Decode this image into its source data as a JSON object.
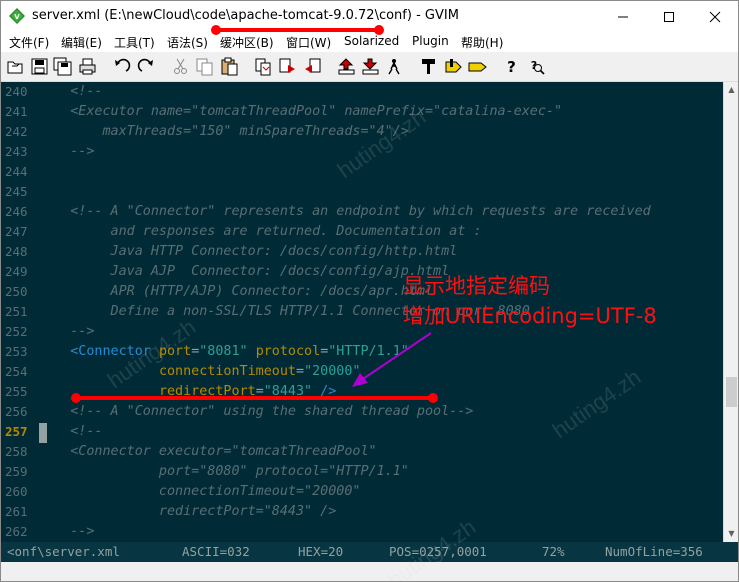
{
  "window": {
    "title": "server.xml (E:\\newCloud\\code\\apache-tomcat-9.0.72\\conf) - GVIM"
  },
  "menu": {
    "items": [
      "文件(F)",
      "编辑(E)",
      "工具(T)",
      "语法(S)",
      "缓冲区(B)",
      "窗口(W)",
      "Solarized",
      "Plugin",
      "帮助(H)"
    ]
  },
  "toolbar": {
    "icons": [
      "open-icon",
      "save-icon",
      "save-all-icon",
      "print-icon",
      "undo-icon",
      "redo-icon",
      "cut-icon",
      "copy-icon",
      "paste-icon",
      "replace-icon",
      "find-next-icon",
      "find-prev-icon",
      "load-session-icon",
      "save-session-icon",
      "run-script-icon",
      "make-icon",
      "run-ctags-icon",
      "jump-tag-icon",
      "help-icon",
      "find-help-icon"
    ]
  },
  "editor": {
    "cursor_line": "257",
    "lines": [
      {
        "num": "240",
        "tokens": [
          {
            "t": "    <!--",
            "c": "comment"
          }
        ]
      },
      {
        "num": "241",
        "tokens": [
          {
            "t": "    <Executor name=\"tomcatThreadPool\" namePrefix=\"catalina-exec-\"",
            "c": "comment"
          }
        ]
      },
      {
        "num": "242",
        "tokens": [
          {
            "t": "        maxThreads=\"150\" minSpareThreads=\"4\"/>",
            "c": "comment"
          }
        ]
      },
      {
        "num": "243",
        "tokens": [
          {
            "t": "    -->",
            "c": "comment"
          }
        ]
      },
      {
        "num": "244",
        "tokens": []
      },
      {
        "num": "245",
        "tokens": []
      },
      {
        "num": "246",
        "tokens": [
          {
            "t": "    <!-- A \"Connector\" represents an endpoint by which requests are received",
            "c": "comment"
          }
        ]
      },
      {
        "num": "247",
        "tokens": [
          {
            "t": "         and responses are returned. Documentation at :",
            "c": "comment"
          }
        ]
      },
      {
        "num": "248",
        "tokens": [
          {
            "t": "         Java HTTP Connector: /docs/config/http.html",
            "c": "comment"
          }
        ]
      },
      {
        "num": "249",
        "tokens": [
          {
            "t": "         Java AJP  Connector: /docs/config/ajp.html",
            "c": "comment"
          }
        ]
      },
      {
        "num": "250",
        "tokens": [
          {
            "t": "         APR (HTTP/AJP) Connector: /docs/apr.html",
            "c": "comment"
          }
        ]
      },
      {
        "num": "251",
        "tokens": [
          {
            "t": "         Define a non-SSL/TLS HTTP/1.1 Connector on port 8080",
            "c": "comment"
          }
        ]
      },
      {
        "num": "252",
        "tokens": [
          {
            "t": "    -->",
            "c": "comment"
          }
        ]
      },
      {
        "num": "253",
        "tokens": [
          {
            "t": "    ",
            "c": "text"
          },
          {
            "t": "<Connector",
            "c": "tag"
          },
          {
            "t": " ",
            "c": "text"
          },
          {
            "t": "port",
            "c": "attr"
          },
          {
            "t": "=",
            "c": "text"
          },
          {
            "t": "\"8081\"",
            "c": "str"
          },
          {
            "t": " ",
            "c": "text"
          },
          {
            "t": "protocol",
            "c": "attr"
          },
          {
            "t": "=",
            "c": "text"
          },
          {
            "t": "\"HTTP/1.1\"",
            "c": "str"
          }
        ]
      },
      {
        "num": "254",
        "tokens": [
          {
            "t": "               ",
            "c": "text"
          },
          {
            "t": "connectionTimeout",
            "c": "attr"
          },
          {
            "t": "=",
            "c": "text"
          },
          {
            "t": "\"20000\"",
            "c": "str"
          }
        ]
      },
      {
        "num": "255",
        "tokens": [
          {
            "t": "               ",
            "c": "text"
          },
          {
            "t": "redirectPort",
            "c": "attr"
          },
          {
            "t": "=",
            "c": "text"
          },
          {
            "t": "\"8443\"",
            "c": "str"
          },
          {
            "t": " />",
            "c": "tag"
          }
        ]
      },
      {
        "num": "256",
        "tokens": [
          {
            "t": "    <!-- A \"Connector\" using the shared thread pool-->",
            "c": "comment"
          }
        ]
      },
      {
        "num": "257",
        "tokens": [
          {
            "t": "    <!--",
            "c": "comment"
          }
        ]
      },
      {
        "num": "258",
        "tokens": [
          {
            "t": "    <Connector executor=\"tomcatThreadPool\"",
            "c": "comment"
          }
        ]
      },
      {
        "num": "259",
        "tokens": [
          {
            "t": "               port=\"8080\" protocol=\"HTTP/1.1\"",
            "c": "comment"
          }
        ]
      },
      {
        "num": "260",
        "tokens": [
          {
            "t": "               connectionTimeout=\"20000\"",
            "c": "comment"
          }
        ]
      },
      {
        "num": "261",
        "tokens": [
          {
            "t": "               redirectPort=\"8443\" />",
            "c": "comment"
          }
        ]
      },
      {
        "num": "262",
        "tokens": [
          {
            "t": "    -->",
            "c": "comment"
          }
        ]
      }
    ]
  },
  "statusbar": {
    "file": "<onf\\server.xml",
    "ascii": "ASCII=032",
    "hex": "HEX=20",
    "pos": "POS=0257,0001",
    "percent": "72%",
    "numlines": "NumOfLine=356"
  },
  "annotations": {
    "line1": "显示地指定编码",
    "line2": "增加URIEncoding=UTF-8"
  },
  "watermark": "huting4.zh",
  "colors": {
    "background": "#002b36",
    "comment": "#586e75",
    "tag": "#268bd2",
    "attribute": "#b58900",
    "string": "#2aa198",
    "annotation": "#ff0000"
  }
}
